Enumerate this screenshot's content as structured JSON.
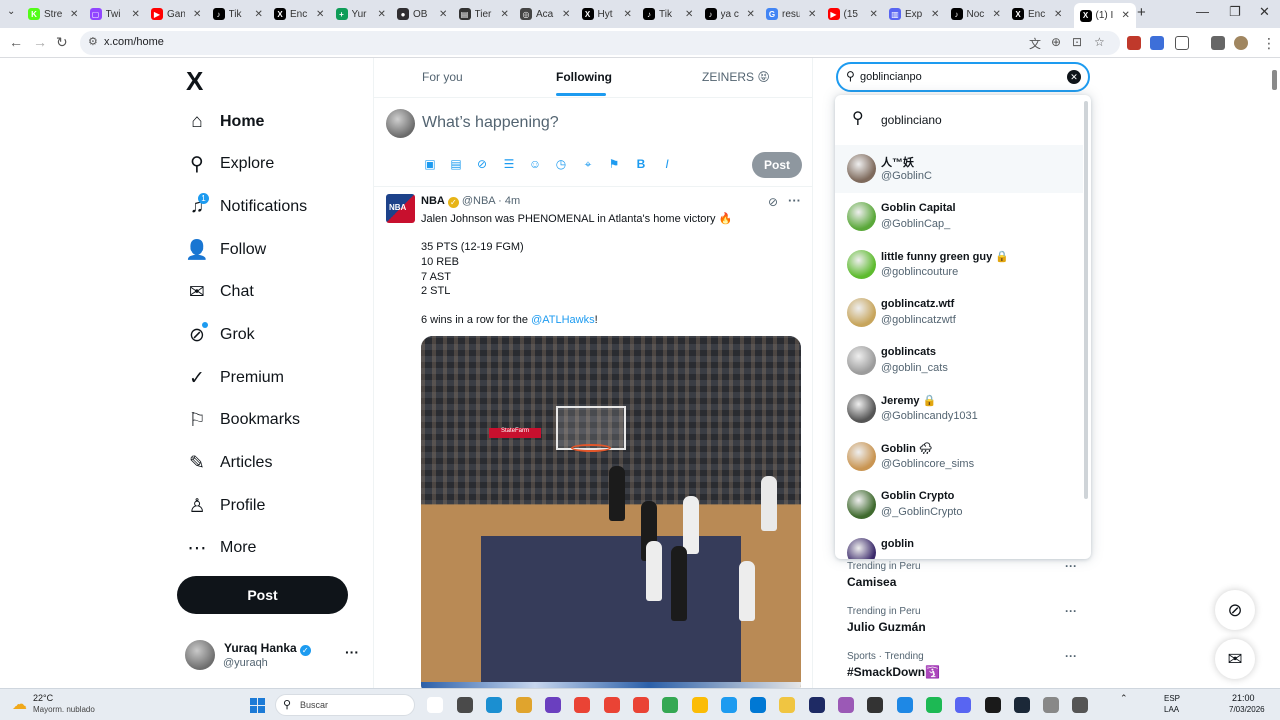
{
  "browser": {
    "tabs": [
      {
        "title": "Stre",
        "color": "#53fc18",
        "glyph": "K"
      },
      {
        "title": "Twi",
        "color": "#9146ff",
        "glyph": "▢"
      },
      {
        "title": "Gan",
        "color": "#ff0000",
        "glyph": "▶"
      },
      {
        "title": "Tik",
        "color": "#000000",
        "glyph": "♪"
      },
      {
        "title": "Enc",
        "color": "#000000",
        "glyph": "X"
      },
      {
        "title": "Yur",
        "color": "#0f9d58",
        "glyph": "+"
      },
      {
        "title": "OB",
        "color": "#302e31",
        "glyph": "●"
      },
      {
        "title": "Tier",
        "color": "#333333",
        "glyph": "▤"
      },
      {
        "title": "Aca",
        "color": "#444444",
        "glyph": "◎"
      },
      {
        "title": "Hyt",
        "color": "#000000",
        "glyph": "X"
      },
      {
        "title": "Tik",
        "color": "#000000",
        "glyph": "♪"
      },
      {
        "title": "ya c",
        "color": "#000000",
        "glyph": "♪"
      },
      {
        "title": "resu",
        "color": "#4285f4",
        "glyph": "G"
      },
      {
        "title": "(15",
        "color": "#ff0000",
        "glyph": "▶"
      },
      {
        "title": "Exp",
        "color": "#5865f2",
        "glyph": "▥"
      },
      {
        "title": "Noc",
        "color": "#000000",
        "glyph": "♪"
      },
      {
        "title": "Enc",
        "color": "#000000",
        "glyph": "X"
      },
      {
        "title": "(1) I",
        "color": "#000000",
        "glyph": "X"
      }
    ],
    "url": "x.com/home"
  },
  "nav": {
    "logo": "X",
    "items": [
      {
        "label": "Home",
        "icon": "home-icon",
        "glyph": "⌂"
      },
      {
        "label": "Explore",
        "icon": "search-icon",
        "glyph": "⚲"
      },
      {
        "label": "Notifications",
        "icon": "bell-icon",
        "glyph": "♫"
      },
      {
        "label": "Follow",
        "icon": "add-person-icon",
        "glyph": "👤"
      },
      {
        "label": "Chat",
        "icon": "mail-icon",
        "glyph": "✉"
      },
      {
        "label": "Grok",
        "icon": "grok-icon",
        "glyph": "⊘"
      },
      {
        "label": "Premium",
        "icon": "premium-icon",
        "glyph": "✓"
      },
      {
        "label": "Bookmarks",
        "icon": "bookmark-icon",
        "glyph": "⚐"
      },
      {
        "label": "Articles",
        "icon": "article-icon",
        "glyph": "✎"
      },
      {
        "label": "Profile",
        "icon": "person-icon",
        "glyph": "♙"
      },
      {
        "label": "More",
        "icon": "more-icon",
        "glyph": "⋯"
      }
    ],
    "notifications_badge": "1",
    "post_button": "Post",
    "account": {
      "name": "Yuraq Hanka",
      "handle": "@yuraqh",
      "verified": true
    }
  },
  "feed": {
    "tabs": [
      "For you",
      "Following",
      "ZEINERS 😝"
    ],
    "active_tab": "Following",
    "composer_placeholder": "What’s happening?",
    "composer_post": "Post",
    "tweet": {
      "author": "NBA",
      "handle": "@NBA",
      "dot": "·",
      "time": "4m",
      "lines": [
        "Jalen Johnson was PHENOMENAL in Atlanta's home victory 🔥",
        "35 PTS (12-19 FGM)",
        "10 REB",
        "7 AST",
        "2 STL",
        "6 wins in a row for the "
      ],
      "mention": "@ATLHawks",
      "after_mention": "!",
      "avatar_text": "NBA",
      "media_banner": "StateFarm"
    }
  },
  "search": {
    "query": "goblincianpo",
    "suggestion": "goblinciano",
    "users": [
      {
        "name": "人™妖",
        "handle": "@GoblinC",
        "avatar": "#7e6a5c",
        "locked": false,
        "emoji": ""
      },
      {
        "name": "Goblin Capital",
        "handle": "@GoblinCap_",
        "avatar": "#5aa83a",
        "locked": false,
        "emoji": ""
      },
      {
        "name": "little funny green guy",
        "handle": "@goblincouture",
        "avatar": "#5dbb2e",
        "locked": true,
        "emoji": ""
      },
      {
        "name": "goblincatz.wtf",
        "handle": "@goblincatzwtf",
        "avatar": "#c7a55c",
        "locked": false,
        "emoji": ""
      },
      {
        "name": "goblincats",
        "handle": "@goblin_cats",
        "avatar": "#9c9c9c",
        "locked": false,
        "emoji": ""
      },
      {
        "name": "Jeremy",
        "handle": "@Goblincandy1031",
        "avatar": "#555555",
        "locked": true,
        "emoji": ""
      },
      {
        "name": "Goblin",
        "handle": "@Goblincore_sims",
        "avatar": "#c99552",
        "locked": false,
        "emoji": "🌧"
      },
      {
        "name": "Goblin Crypto",
        "handle": "@_GoblinCrypto",
        "avatar": "#3f6a2e",
        "locked": false,
        "emoji": ""
      },
      {
        "name": "goblin",
        "handle": "",
        "avatar": "#3b2a6b",
        "locked": false,
        "emoji": ""
      }
    ]
  },
  "trends": [
    {
      "category": "Trending in Peru",
      "name": "Camisea"
    },
    {
      "category": "Trending in Peru",
      "name": "Julio Guzmán"
    },
    {
      "category": "Sports · Trending",
      "name": "#SmackDown🛐"
    }
  ],
  "taskbar": {
    "weather_temp": "22°C",
    "weather_desc": "Mayorm. nublado",
    "search_placeholder": "Buscar",
    "lang_1": "ESP",
    "lang_2": "LAA",
    "time": "21:00",
    "date": "7/03/2026"
  },
  "colors": {
    "accent": "#1d9bf0",
    "text": "#0f1419",
    "muted": "#536471"
  }
}
